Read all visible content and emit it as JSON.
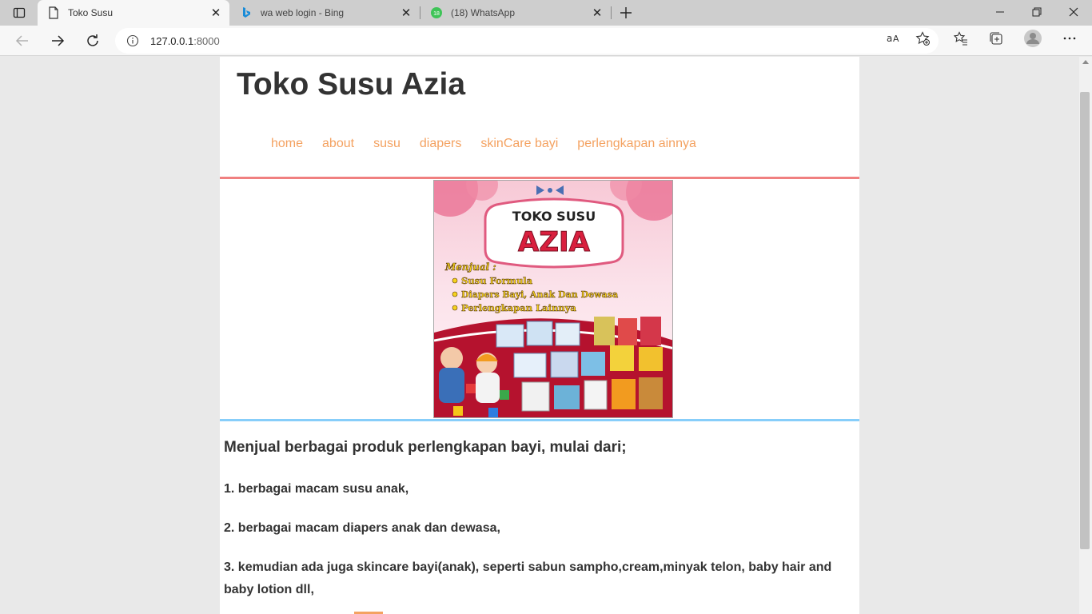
{
  "browser": {
    "tabs": [
      {
        "title": "Toko Susu",
        "active": true
      },
      {
        "title": "wa web login - Bing",
        "active": false
      },
      {
        "title": "(18) WhatsApp",
        "active": false,
        "badge": "18"
      }
    ],
    "address": {
      "host": "127.0.0.1",
      "port": ":8000"
    },
    "colors": {
      "accent_bing": "#1a8cd8",
      "whatsapp": "#3ec457"
    }
  },
  "site": {
    "title": "Toko Susu Azia",
    "menu": [
      "home",
      "about",
      "susu",
      "diapers",
      "skinCare bayi",
      "perlengkapan ainnya"
    ],
    "banner": {
      "heading_small": "TOKO SUSU",
      "heading_big": "AZIA",
      "menjual": "Menjual :",
      "items": [
        "Susu Formula",
        "Diapers Bayi, Anak Dan Dewasa",
        "Perlengkapan Lainnya"
      ]
    },
    "intro": "Menjual berbagai produk perlengkapan bayi, mulai dari;",
    "points": [
      "1. berbagai macam susu anak,",
      "2. berbagai macam diapers anak dan dewasa,",
      "3. kemudian ada juga skincare bayi(anak), seperti sabun sampho,cream,minyak telon, baby hair and baby lotion dll,"
    ],
    "colors": {
      "menu": "#f4a261",
      "rule_top": "#f08080",
      "rule_bottom": "#87cefa"
    }
  }
}
